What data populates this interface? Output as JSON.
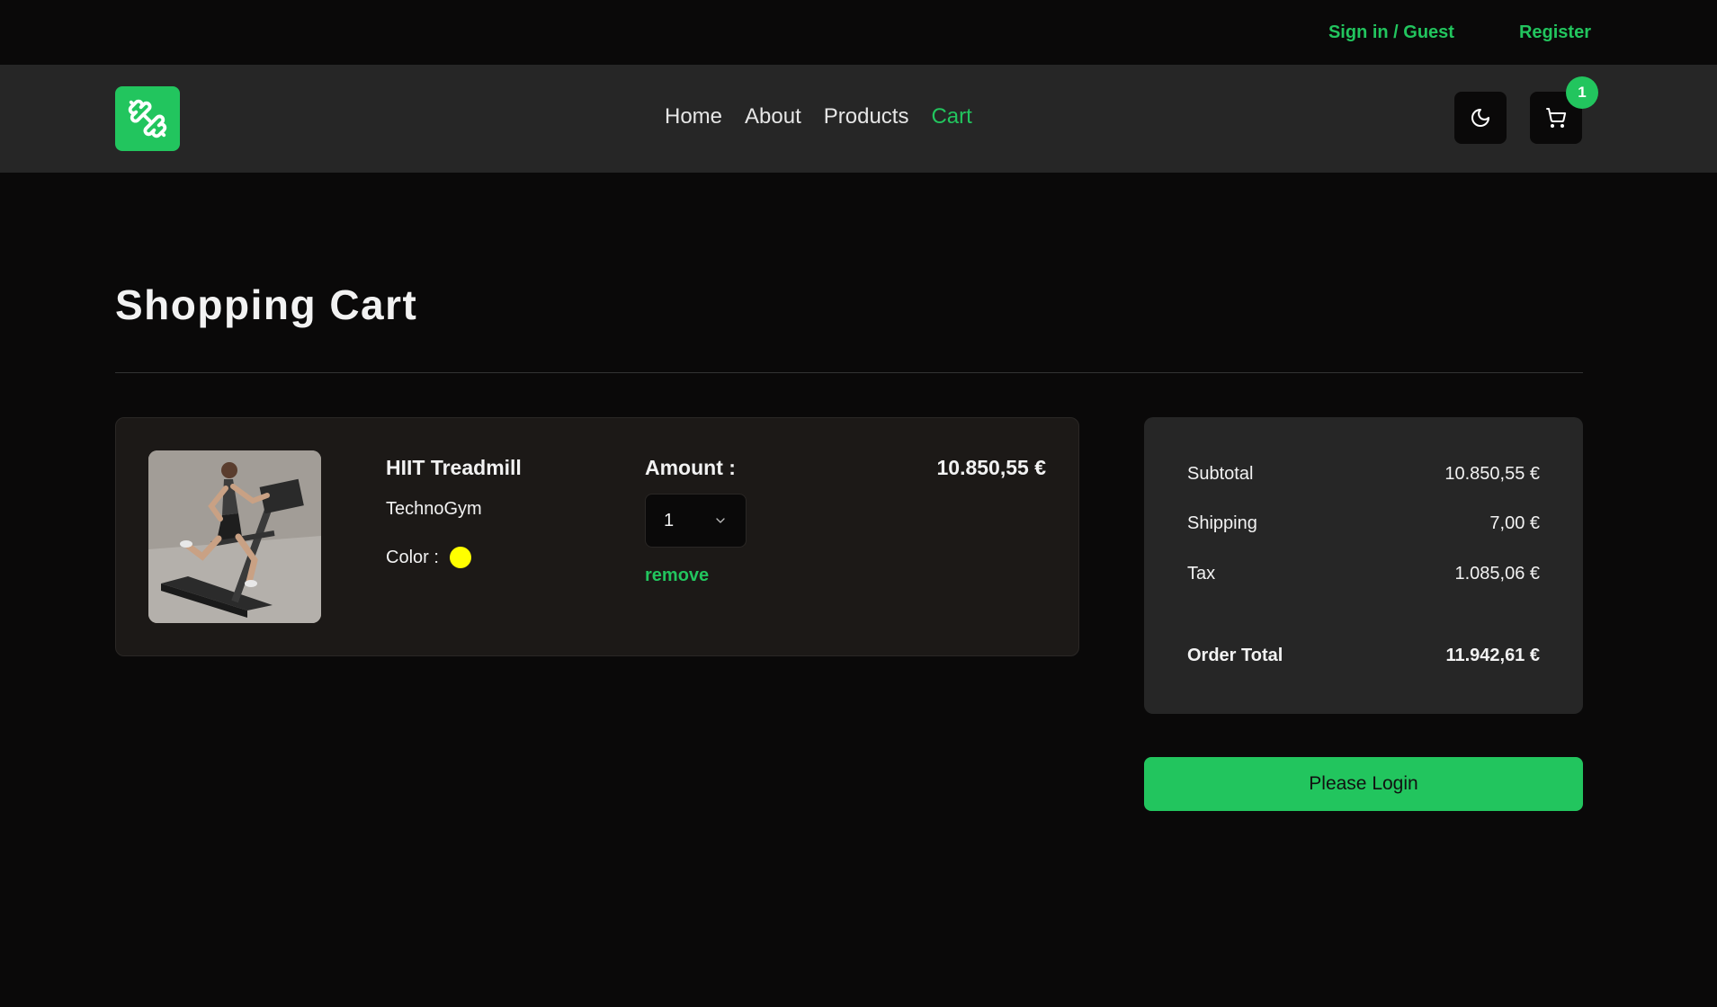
{
  "topbar": {
    "signin_label": "Sign in / Guest",
    "register_label": "Register"
  },
  "navbar": {
    "links": [
      "Home",
      "About",
      "Products",
      "Cart"
    ],
    "active_link": "Cart",
    "cart_count": "1"
  },
  "main": {
    "title": "Shopping Cart"
  },
  "cart_item": {
    "name": "HIIT Treadmill",
    "brand": "TechnoGym",
    "color_label": "Color :",
    "color_value": "#ffff00",
    "amount_label": "Amount :",
    "amount_value": "1",
    "remove_label": "remove",
    "price": "10.850,55 €"
  },
  "summary": {
    "subtotal_label": "Subtotal",
    "subtotal_value": "10.850,55 €",
    "shipping_label": "Shipping",
    "shipping_value": "7,00 €",
    "tax_label": "Tax",
    "tax_value": "1.085,06 €",
    "total_label": "Order Total",
    "total_value": "11.942,61 €"
  },
  "login_button": "Please Login",
  "colors": {
    "accent": "#22c55e",
    "background": "#0a0909",
    "navbar": "#262626"
  }
}
